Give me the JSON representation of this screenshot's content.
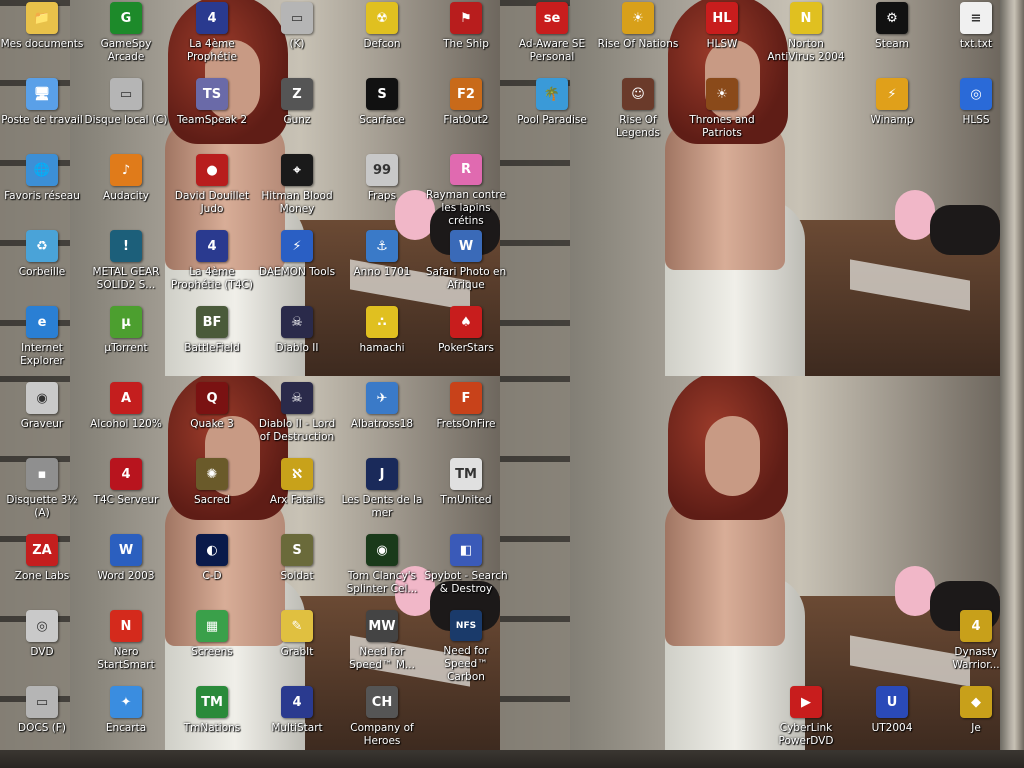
{
  "desktop": {
    "icons": [
      {
        "label": "Mes documents",
        "icon": "folder-documents-icon",
        "color": "#e8c14a",
        "glyph": "📁"
      },
      {
        "label": "Poste de travail",
        "icon": "computer-icon",
        "color": "#5aa0e8",
        "glyph": "🖥"
      },
      {
        "label": "Favoris réseau",
        "icon": "network-icon",
        "color": "#3c8fd6",
        "glyph": "🌐"
      },
      {
        "label": "Corbeille",
        "icon": "recycle-bin-icon",
        "color": "#4aa3d8",
        "glyph": "♻"
      },
      {
        "label": "Internet Explorer",
        "icon": "internet-explorer-icon",
        "color": "#2a7fd4",
        "glyph": "e"
      },
      {
        "label": "Graveur",
        "icon": "cd-burner-icon",
        "color": "#c9c9c9",
        "glyph": "◉"
      },
      {
        "label": "Disquette 3½ (A)",
        "icon": "floppy-icon",
        "color": "#8f8f8f",
        "glyph": "▪"
      },
      {
        "label": "Zone Labs",
        "icon": "zonelabs-icon",
        "color": "#c41e1e",
        "glyph": "ZA"
      },
      {
        "label": "DVD",
        "icon": "dvd-drive-icon",
        "color": "#c9c9c9",
        "glyph": "◎"
      },
      {
        "label": "DOCS (F)",
        "icon": "drive-icon",
        "color": "#b5b5b5",
        "glyph": "▭"
      },
      {
        "label": "GameSpy Arcade",
        "icon": "gamespy-icon",
        "color": "#1d8a2a",
        "glyph": "G"
      },
      {
        "label": "Disque local (C)",
        "icon": "drive-c-icon",
        "color": "#b5b5b5",
        "glyph": "▭"
      },
      {
        "label": "Audacity",
        "icon": "audacity-icon",
        "color": "#e07b1a",
        "glyph": "♪"
      },
      {
        "label": "METAL GEAR SOLID2 S...",
        "icon": "metal-gear-icon",
        "color": "#1c5f7a",
        "glyph": "!"
      },
      {
        "label": "µTorrent",
        "icon": "utorrent-icon",
        "color": "#4c9f2f",
        "glyph": "µ"
      },
      {
        "label": "Alcohol 120%",
        "icon": "alcohol-icon",
        "color": "#c41e1e",
        "glyph": "A"
      },
      {
        "label": "T4C Serveur",
        "icon": "t4c-server-icon",
        "color": "#b8141e",
        "glyph": "4"
      },
      {
        "label": "Word 2003",
        "icon": "word-icon",
        "color": "#2b5fbf",
        "glyph": "W"
      },
      {
        "label": "Nero StartSmart",
        "icon": "nero-icon",
        "color": "#d42a1c",
        "glyph": "N"
      },
      {
        "label": "Encarta",
        "icon": "encarta-icon",
        "color": "#3a8de0",
        "glyph": "✦"
      },
      {
        "label": "La 4ème Prophétie",
        "icon": "t4c-icon",
        "color": "#2a3a8f",
        "glyph": "4"
      },
      {
        "label": "TeamSpeak 2",
        "icon": "teamspeak-icon",
        "color": "#6a6aa8",
        "glyph": "TS"
      },
      {
        "label": "David Douillet Judo",
        "icon": "judo-icon",
        "color": "#b81d1d",
        "glyph": "●"
      },
      {
        "label": "La 4ème Prophétie (T4C)",
        "icon": "t4c-alt-icon",
        "color": "#2a3a8f",
        "glyph": "4"
      },
      {
        "label": "BattleField",
        "icon": "battlefield-icon",
        "color": "#4a5a3a",
        "glyph": "BF"
      },
      {
        "label": "Quake 3",
        "icon": "quake-icon",
        "color": "#7a1212",
        "glyph": "Q"
      },
      {
        "label": "Sacred",
        "icon": "sacred-icon",
        "color": "#6a5a2a",
        "glyph": "✺"
      },
      {
        "label": "C-D",
        "icon": "cd-game-icon",
        "color": "#0a1a4a",
        "glyph": "◐"
      },
      {
        "label": "Screens",
        "icon": "screens-icon",
        "color": "#3aa04a",
        "glyph": "▦"
      },
      {
        "label": "TmNations",
        "icon": "tmnations-icon",
        "color": "#2a8a3a",
        "glyph": "TM"
      },
      {
        "label": "(K)",
        "icon": "drive-k-icon",
        "color": "#b5b5b5",
        "glyph": "▭"
      },
      {
        "label": "Gunz",
        "icon": "gunz-icon",
        "color": "#555555",
        "glyph": "Z"
      },
      {
        "label": "Hitman Blood Money",
        "icon": "hitman-icon",
        "color": "#1a1a1a",
        "glyph": "⌖"
      },
      {
        "label": "DAEMON Tools",
        "icon": "daemon-tools-icon",
        "color": "#2a5fc4",
        "glyph": "⚡"
      },
      {
        "label": "Diablo II",
        "icon": "diablo-icon",
        "color": "#2a2a4a",
        "glyph": "☠"
      },
      {
        "label": "Diablo II - Lord of Destruction",
        "icon": "diablo-lod-icon",
        "color": "#2a2a4a",
        "glyph": "☠"
      },
      {
        "label": "Arx Fatalis",
        "icon": "arx-fatalis-icon",
        "color": "#c8a21a",
        "glyph": "ℵ"
      },
      {
        "label": "Soldat",
        "icon": "soldat-icon",
        "color": "#6a6a3a",
        "glyph": "S"
      },
      {
        "label": "GrabIt",
        "icon": "grabit-icon",
        "color": "#e0c040",
        "glyph": "✎"
      },
      {
        "label": "MultiStart",
        "icon": "multistart-icon",
        "color": "#2a3a8f",
        "glyph": "4"
      },
      {
        "label": "Defcon",
        "icon": "defcon-icon",
        "color": "#e0c020",
        "glyph": "☢"
      },
      {
        "label": "Scarface",
        "icon": "scarface-icon",
        "color": "#111111",
        "glyph": "S"
      },
      {
        "label": "Fraps",
        "icon": "fraps-icon",
        "color": "#c8c8c8",
        "glyph": "99"
      },
      {
        "label": "Anno 1701",
        "icon": "anno-icon",
        "color": "#3a7ac8",
        "glyph": "⚓"
      },
      {
        "label": "hamachi",
        "icon": "hamachi-icon",
        "color": "#e0c020",
        "glyph": "∴"
      },
      {
        "label": "Albatross18",
        "icon": "albatross-icon",
        "color": "#3a7ac8",
        "glyph": "✈"
      },
      {
        "label": "Les Dents de la mer",
        "icon": "jaws-icon",
        "color": "#1a2a5a",
        "glyph": "J"
      },
      {
        "label": "Tom Clancy's Splinter Cel...",
        "icon": "splinter-cell-icon",
        "color": "#1a3a1a",
        "glyph": "◉"
      },
      {
        "label": "Need for Speed™ M...",
        "icon": "nfs-mw-icon",
        "color": "#444444",
        "glyph": "MW"
      },
      {
        "label": "Company of Heroes",
        "icon": "coh-icon",
        "color": "#555555",
        "glyph": "CH"
      },
      {
        "label": "The Ship",
        "icon": "the-ship-icon",
        "color": "#b81d1d",
        "glyph": "⚑"
      },
      {
        "label": "FlatOut2",
        "icon": "flatout-icon",
        "color": "#c86a1a",
        "glyph": "F2"
      },
      {
        "label": "Rayman contre les lapins crétins",
        "icon": "rayman-icon",
        "color": "#e06ab0",
        "glyph": "R"
      },
      {
        "label": "Safari Photo en Afrique",
        "icon": "safari-icon",
        "color": "#3a6ab8",
        "glyph": "W"
      },
      {
        "label": "PokerStars",
        "icon": "pokerstars-icon",
        "color": "#c81d1d",
        "glyph": "♠"
      },
      {
        "label": "FretsOnFire",
        "icon": "fretsonfire-icon",
        "color": "#c8421a",
        "glyph": "F"
      },
      {
        "label": "TmUnited",
        "icon": "tmunited-icon",
        "color": "#e0e0e0",
        "glyph": "TM"
      },
      {
        "label": "Spybot - Search & Destroy",
        "icon": "spybot-icon",
        "color": "#3a5ab8",
        "glyph": "◧"
      },
      {
        "label": "Need for Speed™ Carbon",
        "icon": "nfs-carbon-icon",
        "color": "#1a3a6a",
        "glyph": "NFS"
      },
      {
        "label": "Ad-Aware SE Personal",
        "icon": "adaware-icon",
        "color": "#c81d1d",
        "glyph": "se"
      },
      {
        "label": "Pool Paradise",
        "icon": "pool-paradise-icon",
        "color": "#3a9ad8",
        "glyph": "🌴"
      },
      {
        "label": "Rise Of Nations",
        "icon": "rise-of-nations-icon",
        "color": "#d8a01a",
        "glyph": "☀"
      },
      {
        "label": "Rise Of Legends",
        "icon": "rise-of-legends-icon",
        "color": "#6a3a2a",
        "glyph": "☺"
      },
      {
        "label": "HLSW",
        "icon": "hlsw-icon",
        "color": "#c81d1d",
        "glyph": "HL"
      },
      {
        "label": "Thrones and Patriots",
        "icon": "thrones-patriots-icon",
        "color": "#8a4a1a",
        "glyph": "☀"
      },
      {
        "label": "Norton AntiVirus 2004",
        "icon": "norton-icon",
        "color": "#e0c020",
        "glyph": "N"
      },
      {
        "label": "Steam",
        "icon": "steam-icon",
        "color": "#111111",
        "glyph": "⚙"
      },
      {
        "label": "Winamp",
        "icon": "winamp-icon",
        "color": "#e0a01a",
        "glyph": "⚡"
      },
      {
        "label": "txt.txt",
        "icon": "text-file-icon",
        "color": "#f0f0f0",
        "glyph": "≡"
      },
      {
        "label": "HLSS",
        "icon": "hlss-icon",
        "color": "#2a6ad8",
        "glyph": "◎"
      },
      {
        "label": "CyberLink PowerDVD",
        "icon": "powerdvd-icon",
        "color": "#c81d1d",
        "glyph": "▶"
      },
      {
        "label": "UT2004",
        "icon": "ut2004-icon",
        "color": "#2a4ab8",
        "glyph": "U"
      },
      {
        "label": "Dynasty Warrior...",
        "icon": "dynasty-warriors-icon",
        "color": "#c8a01a",
        "glyph": "4"
      },
      {
        "label": "Je",
        "icon": "je-icon",
        "color": "#c8a01a",
        "glyph": "◆"
      }
    ]
  }
}
